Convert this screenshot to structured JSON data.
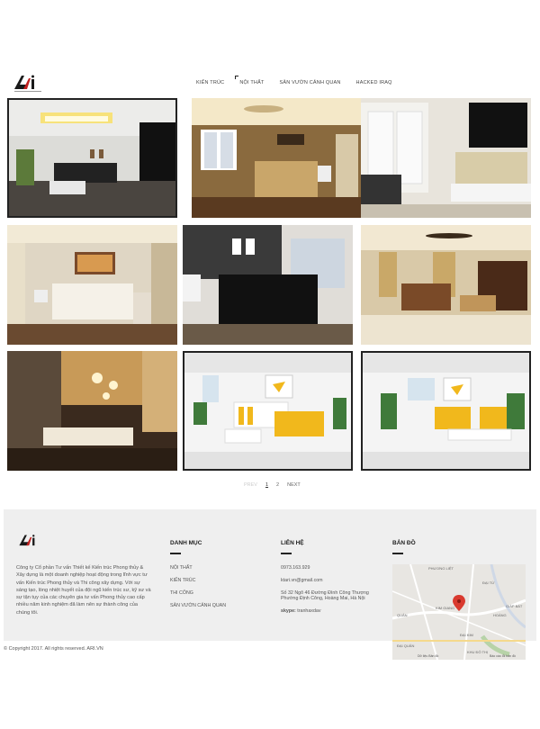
{
  "nav": {
    "items": [
      "KIẾN TRÚC",
      "NỘI THẤT",
      "SÂN VƯỜN CẢNH QUAN",
      "HACKED IRAQ"
    ]
  },
  "pagination": {
    "prev": "PREV",
    "pages": [
      "1",
      "2"
    ],
    "next": "NEXT"
  },
  "footer": {
    "about": "Công ty Cổ phần Tư vấn Thiết kế Kiến trúc Phong thủy & Xây dựng là một doanh nghiệp hoạt động trong lĩnh vực tư vấn Kiến trúc Phong thủy và Thi công xây dựng. Với sự sáng tạo, lòng nhiệt huyết của đội ngũ kiến trúc sư, kỹ sư và sự tận tụy của các chuyên gia tư vấn Phong thủy cao cấp nhiều năm kinh nghiệm đã làm nên sự thành công của chúng tôi.",
    "menu_title": "DANH MỤC",
    "menu": [
      "NỘI THẤT",
      "KIẾN TRÚC",
      "THI CÔNG",
      "SÂN VƯỜN CẢNH QUAN"
    ],
    "contact_title": "LIÊN HỆ",
    "phone": "0973.163.929",
    "email": "ktari.vn@gmail.com",
    "address": "Số 32 Ngõ 46 Đường Đình Công Thượng Phường Định Công, Hoàng Mai, Hà Nội",
    "skype_label": "skype:",
    "skype": "tranhaxdav",
    "map_title": "BẢN ĐỒ",
    "copyright": "© Copyright 2017. All rights reserved. ARI.VN"
  },
  "map": {
    "labels": [
      "PHƯƠNG LIỆT",
      "KIM GIANG",
      "ĐẠI KIM",
      "ĐẠI TỪ",
      "GIÁP BÁT",
      "HOÀNG",
      "KHU ĐÔ THỊ",
      "QUÂN",
      "ĐẠI QUÂN"
    ],
    "attribution": "Dữ liệu Bản đồ",
    "attribution2": "Báo cáo lỗi bản đồ"
  },
  "colors": {
    "footer_bg": "#efefef",
    "logo_red": "#c0201f",
    "marker": "#d93a2f",
    "accent_yellow": "#f1b81c"
  }
}
